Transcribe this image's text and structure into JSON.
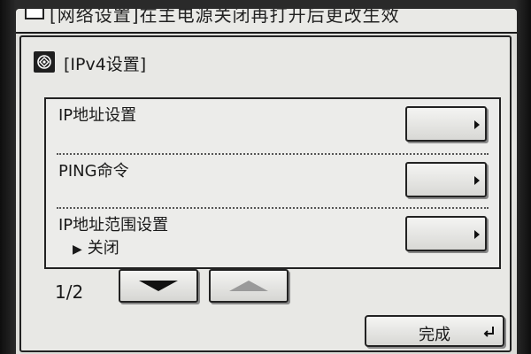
{
  "notice": {
    "text": "[网络设置]在主电源关闭再打开后更改生效"
  },
  "title": {
    "text": "[IPv4设置]"
  },
  "rows": [
    {
      "label": "IP地址设置",
      "sub": ""
    },
    {
      "label": "PING命令",
      "sub": ""
    },
    {
      "label": "IP地址范围设置",
      "sub": "关闭"
    }
  ],
  "pagination": {
    "indicator": "1/2"
  },
  "footer": {
    "done_label": "完成"
  },
  "icons": {
    "title_icon": "network-settings-icon",
    "row_button_icon": "chevron-right-icon",
    "down_icon": "arrow-down-icon",
    "up_icon": "arrow-up-icon",
    "done_icon": "enter-icon"
  },
  "colors": {
    "screen_bg": "#e6e6e3",
    "ink": "#1a1a1a",
    "disabled_arrow": "#9a9a9a"
  }
}
